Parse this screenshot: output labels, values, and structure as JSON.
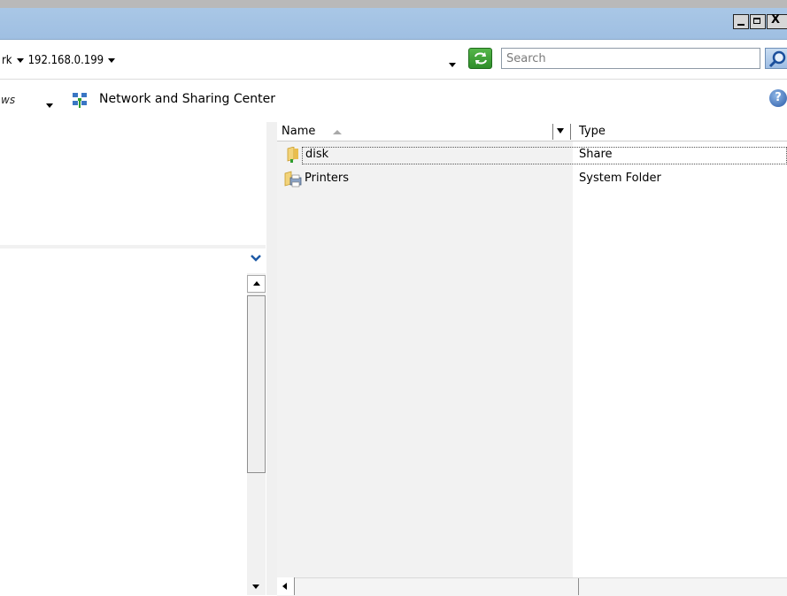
{
  "address_bar": {
    "crumbs": [
      "rk",
      "192.168.0.199"
    ],
    "search_placeholder": "Search"
  },
  "command_bar": {
    "views_label": "ws",
    "network_center_label": "Network and Sharing Center",
    "help_glyph": "?"
  },
  "file_list": {
    "columns": [
      "Name",
      "Type"
    ],
    "rows": [
      {
        "name": "disk",
        "type": "Share",
        "icon": "share-folder-icon"
      },
      {
        "name": "Printers",
        "type": "System Folder",
        "icon": "printers-icon"
      }
    ]
  },
  "window": {
    "close_glyph": "X"
  },
  "colors": {
    "titlebar": "#a9c7e6",
    "column_bg": "#f2f2f2",
    "refresh_green": "#3f9e36"
  }
}
